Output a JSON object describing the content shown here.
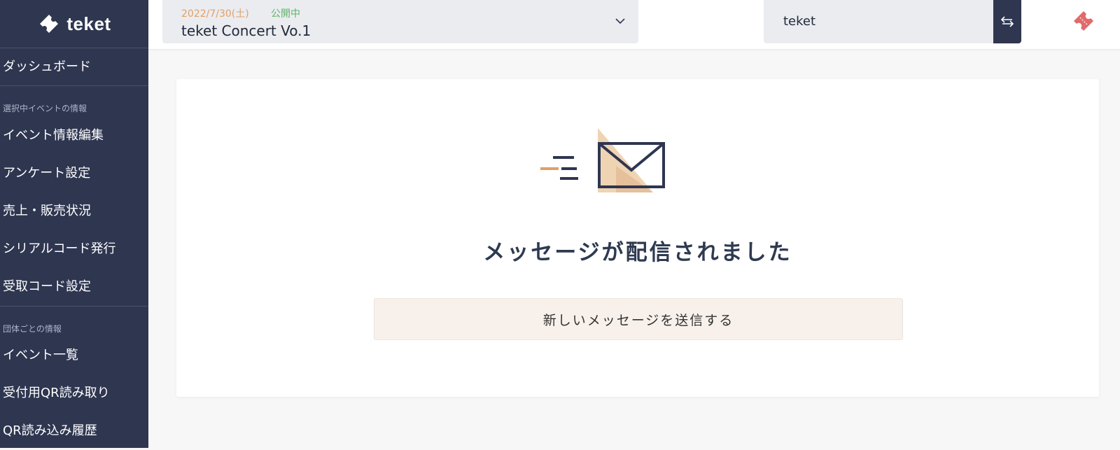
{
  "brand": {
    "name": "teket"
  },
  "sidebar": {
    "dashboard": "ダッシュボード",
    "section_event": "選択中イベントの情報",
    "event_items": [
      "イベント情報編集",
      "アンケート設定",
      "売上・販売状況",
      "シリアルコード発行",
      "受取コード設定"
    ],
    "section_org": "団体ごとの情報",
    "org_items": [
      "イベント一覧",
      "受付用QR読み取り",
      "QR読み込み履歴"
    ]
  },
  "header": {
    "event_date": "2022/7/30(土)",
    "event_status": "公開中",
    "event_title": "teket Concert Vo.1",
    "org_name": "teket"
  },
  "main": {
    "message": "メッセージが配信されました",
    "new_message_button": "新しいメッセージを送信する"
  },
  "colors": {
    "sidebar_bg": "#2e3650",
    "accent_orange": "#e0a067",
    "status_green": "#5fb36a",
    "ticket_red": "#e06b6b"
  }
}
